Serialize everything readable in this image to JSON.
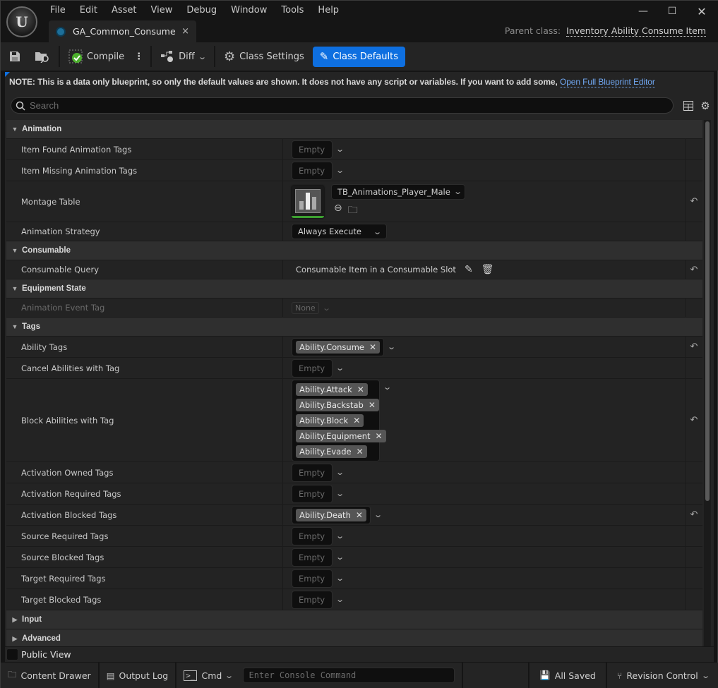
{
  "menu": [
    "File",
    "Edit",
    "Asset",
    "View",
    "Debug",
    "Window",
    "Tools",
    "Help"
  ],
  "window_controls": {
    "minimize": "—",
    "maximize": "☐",
    "close": "✕"
  },
  "tab": {
    "title": "GA_Common_Consume",
    "close": "×"
  },
  "parent_class": {
    "label": "Parent class:",
    "value": "Inventory Ability Consume Item"
  },
  "toolbar": {
    "compile": "Compile",
    "diff": "Diff",
    "class_settings": "Class Settings",
    "class_defaults": "Class Defaults"
  },
  "note": {
    "text": "NOTE: This is a data only blueprint, so only the default values are shown.  It does not have any script or variables.  If you want to add some,",
    "link": "Open Full Blueprint Editor"
  },
  "search": {
    "placeholder": "Search"
  },
  "empty_label": "Empty",
  "categories": {
    "animation": "Animation",
    "consumable": "Consumable",
    "equipment_state": "Equipment State",
    "tags": "Tags",
    "input": "Input",
    "advanced": "Advanced"
  },
  "properties": {
    "item_found": "Item Found Animation Tags",
    "item_missing": "Item Missing Animation Tags",
    "montage_table": {
      "label": "Montage Table",
      "value": "TB_Animations_Player_Male"
    },
    "animation_strategy": {
      "label": "Animation Strategy",
      "value": "Always Execute"
    },
    "consumable_query": {
      "label": "Consumable Query",
      "value": "Consumable Item in a Consumable Slot"
    },
    "animation_event_tag": {
      "label": "Animation Event Tag",
      "value": "None"
    },
    "ability_tags": {
      "label": "Ability Tags",
      "tags": [
        "Ability.Consume"
      ]
    },
    "cancel_abilities": "Cancel Abilities with Tag",
    "block_abilities": {
      "label": "Block Abilities with Tag",
      "tags": [
        "Ability.Attack",
        "Ability.Backstab",
        "Ability.Block",
        "Ability.Equipment",
        "Ability.Evade"
      ]
    },
    "activation_owned": "Activation Owned Tags",
    "activation_required": "Activation Required Tags",
    "activation_blocked": {
      "label": "Activation Blocked Tags",
      "tags": [
        "Ability.Death"
      ]
    },
    "source_required": "Source Required Tags",
    "source_blocked": "Source Blocked Tags",
    "target_required": "Target Required Tags",
    "target_blocked": "Target Blocked Tags"
  },
  "public_view": "Public View",
  "statusbar": {
    "content_drawer": "Content Drawer",
    "output_log": "Output Log",
    "cmd": "Cmd",
    "console_placeholder": "Enter Console Command",
    "all_saved": "All Saved",
    "revision_control": "Revision Control"
  }
}
